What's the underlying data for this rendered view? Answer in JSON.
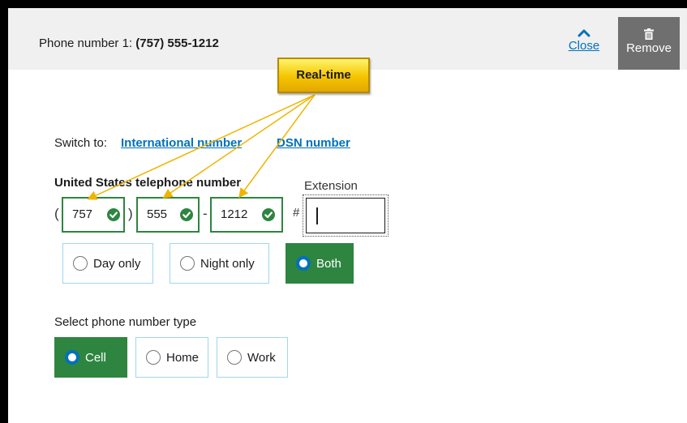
{
  "header": {
    "title_prefix": "Phone number 1: ",
    "title_value": "(757) 555-1212",
    "close_label": "Close",
    "remove_label": "Remove",
    "close_icon": "chevron-up-icon",
    "remove_icon": "trash-icon"
  },
  "callout": {
    "label": "Real-time"
  },
  "switch": {
    "prefix": "Switch to:",
    "international_label": "International number",
    "dsn_label": "DSN number"
  },
  "phone": {
    "section_label": "United States telephone number",
    "extension_label": "Extension",
    "open_paren": "(",
    "close_paren": ")",
    "dash": "-",
    "hash": "#",
    "area_code": "757",
    "prefix": "555",
    "line": "1212",
    "extension_value": "",
    "valid_icon": "check-circle-icon"
  },
  "time_options": {
    "items": [
      "Day only",
      "Night only",
      "Both"
    ],
    "selected": "Both"
  },
  "type_options": {
    "label": "Select phone number type",
    "items": [
      "Cell",
      "Home",
      "Work"
    ],
    "selected": "Cell"
  },
  "colors": {
    "valid_green": "#2e8540",
    "link_blue": "#0071bb",
    "callout_yellow": "#f5c400",
    "remove_gray": "#6f6f6f",
    "header_gray": "#f0f0f0",
    "tile_border": "#9fd6f0"
  }
}
